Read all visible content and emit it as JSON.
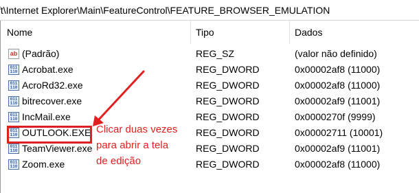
{
  "path": "ft\\Internet Explorer\\Main\\FeatureControl\\FEATURE_BROWSER_EMULATION",
  "columns": {
    "name": "Nome",
    "type": "Tipo",
    "data": "Dados"
  },
  "rows": [
    {
      "icon": "string-value-icon",
      "name": "(Padrão)",
      "type": "REG_SZ",
      "data": "(valor não definido)"
    },
    {
      "icon": "dword-value-icon",
      "name": "Acrobat.exe",
      "type": "REG_DWORD",
      "data": "0x00002af8 (11000)"
    },
    {
      "icon": "dword-value-icon",
      "name": "AcroRd32.exe",
      "type": "REG_DWORD",
      "data": "0x00002af8 (11000)"
    },
    {
      "icon": "dword-value-icon",
      "name": "bitrecover.exe",
      "type": "REG_DWORD",
      "data": "0x00002af9 (11001)"
    },
    {
      "icon": "dword-value-icon",
      "name": "IncMail.exe",
      "type": "REG_DWORD",
      "data": "0x0000270f (9999)"
    },
    {
      "icon": "dword-value-icon",
      "name": "OUTLOOK.EXE",
      "type": "REG_DWORD",
      "data": "0x00002711 (10001)"
    },
    {
      "icon": "dword-value-icon",
      "name": "TeamViewer.exe",
      "type": "REG_DWORD",
      "data": "0x00002af9 (11001)"
    },
    {
      "icon": "dword-value-icon",
      "name": "Zoom.exe",
      "type": "REG_DWORD",
      "data": "0x00002af8 (11000)"
    }
  ],
  "annotation": {
    "lines": [
      "Clicar duas vezes",
      "para abrir a tela",
      "de edição"
    ],
    "color": "#e02020"
  },
  "icons": {
    "string": "ab",
    "binary_top": "011",
    "binary_bottom": "110"
  }
}
